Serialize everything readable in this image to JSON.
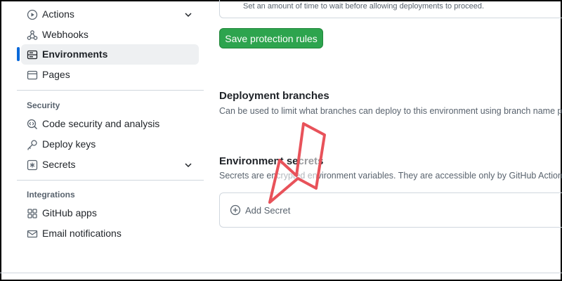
{
  "sidebar": {
    "items_top": [
      {
        "label": "Actions",
        "icon": "play-icon",
        "has_chevron": true
      },
      {
        "label": "Webhooks",
        "icon": "webhook-icon",
        "has_chevron": false
      },
      {
        "label": "Environments",
        "icon": "server-icon",
        "has_chevron": false,
        "active": true
      },
      {
        "label": "Pages",
        "icon": "browser-icon",
        "has_chevron": false
      }
    ],
    "security_title": "Security",
    "security_items": [
      {
        "label": "Code security and analysis",
        "icon": "codescan-icon",
        "has_chevron": false
      },
      {
        "label": "Deploy keys",
        "icon": "key-icon",
        "has_chevron": false
      },
      {
        "label": "Secrets",
        "icon": "asterisk-icon",
        "has_chevron": true
      }
    ],
    "integrations_title": "Integrations",
    "integrations_items": [
      {
        "label": "GitHub apps",
        "icon": "apps-icon"
      },
      {
        "label": "Email notifications",
        "icon": "mail-icon"
      }
    ]
  },
  "main": {
    "wait_timer_desc": "Set an amount of time to wait before allowing deployments to proceed.",
    "save_button": "Save protection rules",
    "deployment_branches": {
      "title": "Deployment branches",
      "desc": "Can be used to limit what branches can deploy to this environment using branch name p"
    },
    "environment_secrets": {
      "title": "Environment secrets",
      "desc": "Secrets are encrypted environment variables. They are accessible only by GitHub Action"
    },
    "add_secret_label": "Add Secret"
  },
  "colors": {
    "accent": "#0969da",
    "success": "#2da44e",
    "arrow": "#e8525a"
  }
}
